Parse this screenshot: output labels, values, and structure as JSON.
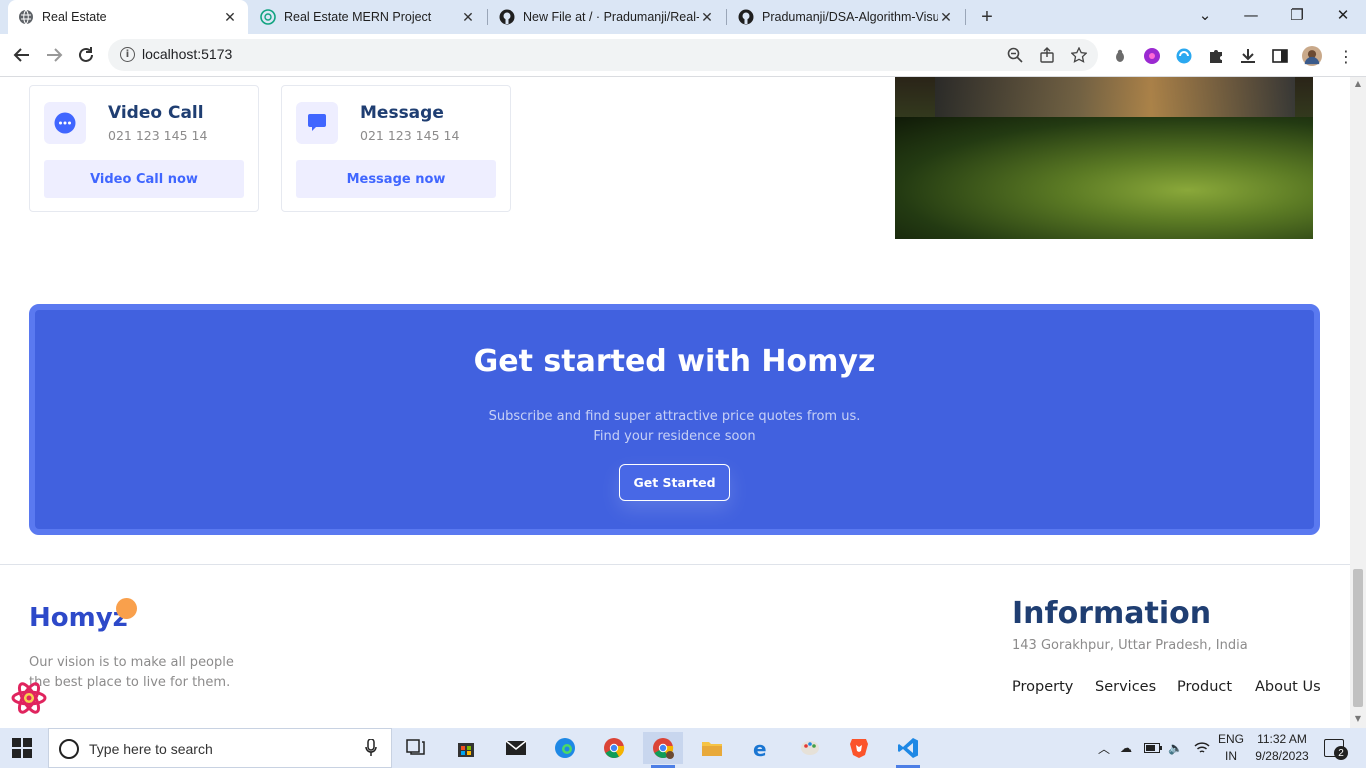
{
  "browser": {
    "tabs": [
      {
        "title": "Real Estate",
        "active": true
      },
      {
        "title": "Real Estate MERN Project",
        "active": false
      },
      {
        "title": "New File at / · Pradumanji/Real-E",
        "active": false
      },
      {
        "title": "Pradumanji/DSA-Algorithm-Visu",
        "active": false
      }
    ],
    "new_tab_label": "+",
    "url": "localhost:5173"
  },
  "contact_cards": [
    {
      "title": "Video Call",
      "phone": "021 123 145 14",
      "button": "Video Call now",
      "icon": "chat-dots-icon"
    },
    {
      "title": "Message",
      "phone": "021 123 145 14",
      "button": "Message now",
      "icon": "message-bubble-icon"
    }
  ],
  "cta": {
    "title": "Get started with Homyz",
    "subtitle_line1": "Subscribe and find super attractive price quotes from us.",
    "subtitle_line2": "Find your residence soon",
    "button": "Get Started"
  },
  "footer": {
    "brand": "Homyz",
    "vision": "Our vision is to make all people the best place to live for them.",
    "info_title": "Information",
    "address": "143 Gorakhpur, Uttar Pradesh, India",
    "links": [
      "Property",
      "Services",
      "Product",
      "About Us"
    ]
  },
  "taskbar": {
    "search_placeholder": "Type here to search",
    "lang_line1": "ENG",
    "lang_line2": "IN",
    "time": "11:32 AM",
    "date": "9/28/2023",
    "notification_count": "2"
  },
  "colors": {
    "primary": "#4161df",
    "heading": "#1f3e72",
    "accent_orange": "#f9a04c",
    "card_button_bg": "#eeeeff"
  }
}
